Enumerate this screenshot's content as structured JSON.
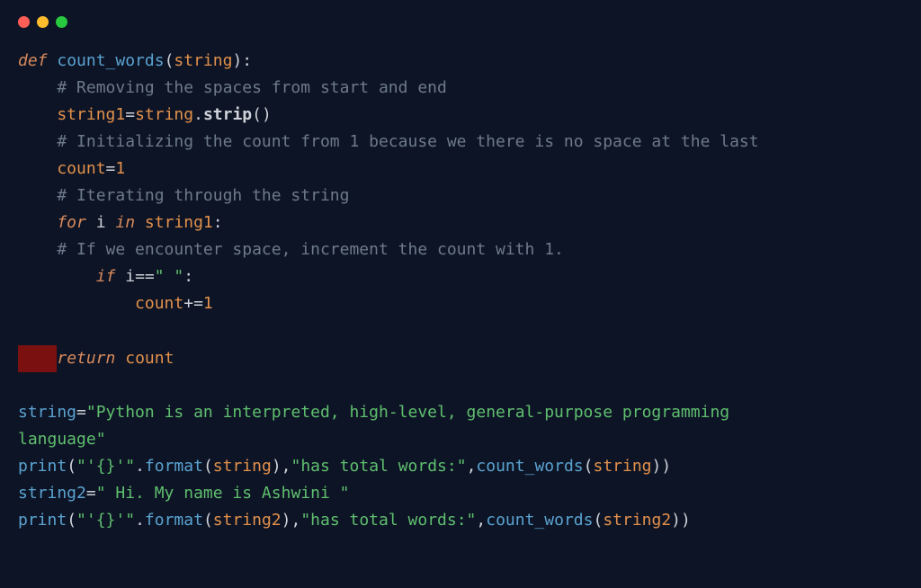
{
  "c": {
    "l1_def": "def",
    "l1_fn": " count_words",
    "l1_paren_o": "(",
    "l1_param": "string",
    "l1_paren_c": "):",
    "l2": "    # Removing the spaces from start and end",
    "l3_var": "    string1",
    "l3_eq": "=",
    "l3_src": "string",
    "l3_dot": ".",
    "l3_method": "strip",
    "l3_call": "()",
    "l4": "    # Initializing the count from 1 because we there is no space at the last",
    "l5_var": "    count",
    "l5_eq": "=",
    "l5_val": "1",
    "l6": "    # Iterating through the string",
    "l7_for": "    for",
    "l7_i": " i ",
    "l7_in": "in",
    "l7_tgt": " string1",
    "l7_colon": ":",
    "l8": "    # If we encounter space, increment the count with 1.",
    "l9_if": "        if",
    "l9_i": " i",
    "l9_eq": "==",
    "l9_str": "\" \"",
    "l9_colon": ":",
    "l10_var": "            count",
    "l10_op": "+=",
    "l10_val": "1",
    "l12_block": "    ",
    "l12_ret": "return",
    "l12_val": " count",
    "l14_var": "string",
    "l14_eq": "=",
    "l14_str": "\"Python is an interpreted, high-level, general-purpose programming ",
    "l15_str": "language\"",
    "l16_print": "print",
    "l16_paren_o": "(",
    "l16_str1": "\"'{}'\"",
    "l16_dot": ".",
    "l16_fmt": "format",
    "l16_paren2_o": "(",
    "l16_arg1": "string",
    "l16_paren2_c": "),",
    "l16_str2": "\"has total words:\"",
    "l16_comma": ",",
    "l16_call": "count_words",
    "l16_paren3_o": "(",
    "l16_arg2": "string",
    "l16_paren3_c": "))",
    "l17_var": "string2",
    "l17_eq": "=",
    "l17_str": "\" Hi. My name is Ashwini \"",
    "l18_print": "print",
    "l18_paren_o": "(",
    "l18_str1": "\"'{}'\"",
    "l18_dot": ".",
    "l18_fmt": "format",
    "l18_paren2_o": "(",
    "l18_arg1": "string2",
    "l18_paren2_c": "),",
    "l18_str2": "\"has total words:\"",
    "l18_comma": ",",
    "l18_call": "count_words",
    "l18_paren3_o": "(",
    "l18_arg2": "string2",
    "l18_paren3_c": "))"
  }
}
